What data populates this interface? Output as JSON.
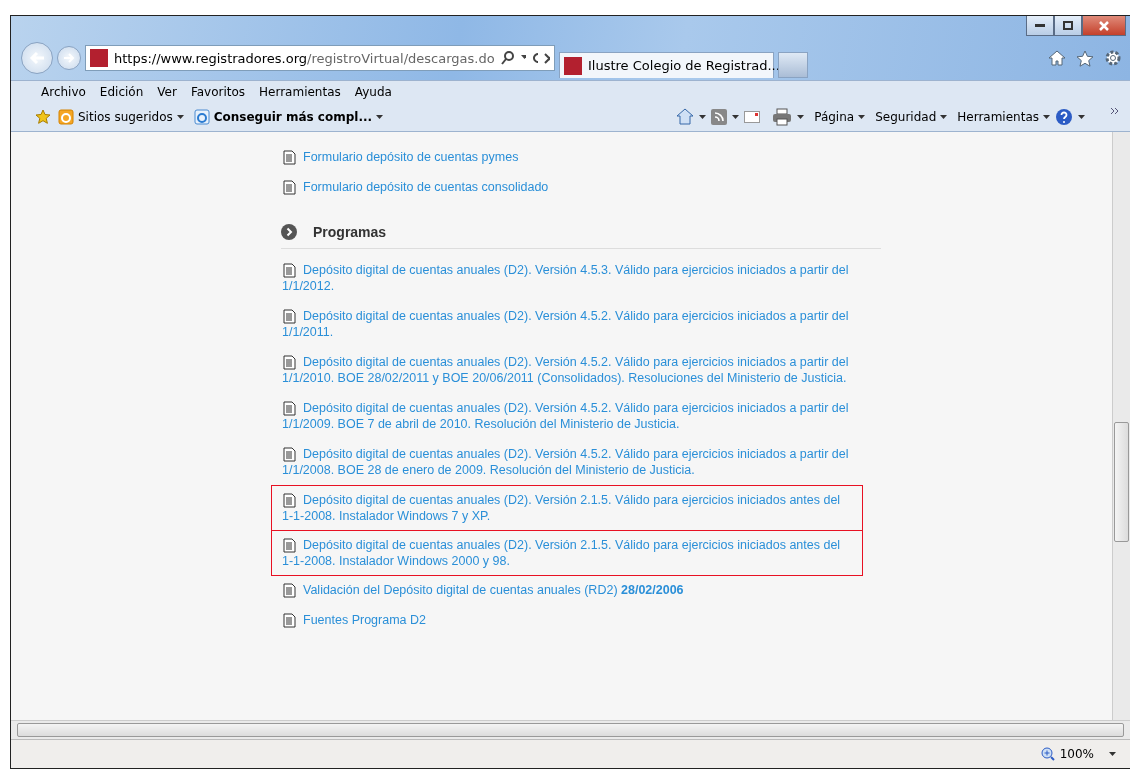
{
  "address_bar": {
    "host": "https://www.registradores.org",
    "path": "/registroVirtual/descargas.do"
  },
  "tab": {
    "title": "Ilustre Colegio de Registrad..."
  },
  "menu": [
    "Archivo",
    "Edición",
    "Ver",
    "Favoritos",
    "Herramientas",
    "Ayuda"
  ],
  "favorites_bar": [
    {
      "label": "Sitios sugeridos",
      "bold": false
    },
    {
      "label": "Conseguir más compl...",
      "bold": true
    }
  ],
  "command_bar": [
    "Página",
    "Seguridad",
    "Herramientas"
  ],
  "forms": [
    {
      "text": "Formulario depósito de cuentas pymes"
    },
    {
      "text": "Formulario depósito de cuentas consolidado"
    }
  ],
  "section": {
    "title": "Programas"
  },
  "programs": [
    {
      "text": "Depósito digital de cuentas anuales (D2). Versión 4.5.3. Válido para ejercicios iniciados a partir del 1/1/2012.",
      "highlighted": false
    },
    {
      "text": "Depósito digital de cuentas anuales (D2). Versión 4.5.2. Válido para ejercicios iniciados a partir del 1/1/2011.",
      "highlighted": false
    },
    {
      "text": "Depósito digital de cuentas anuales (D2). Versión 4.5.2. Válido para ejercicios iniciados a partir del 1/1/2010. BOE 28/02/2011 y BOE 20/06/2011 (Consolidados). Resoluciones del Ministerio de Justicia.",
      "highlighted": false
    },
    {
      "text": "Depósito digital de cuentas anuales (D2). Versión 4.5.2. Válido para ejercicios iniciados a partir del 1/1/2009. BOE 7 de abril de 2010. Resolución del Ministerio de Justicia.",
      "highlighted": false
    },
    {
      "text": "Depósito digital de cuentas anuales (D2). Versión 4.5.2. Válido para ejercicios iniciados a partir del 1/1/2008. BOE 28 de enero de 2009. Resolución del Ministerio de Justicia.",
      "highlighted": false
    },
    {
      "text": "Depósito digital de cuentas anuales (D2). Versión 2.1.5. Válido para ejercicios iniciados antes del 1-1-2008. Instalador Windows 7 y XP.",
      "highlighted": true
    },
    {
      "text": "Depósito digital de cuentas anuales (D2). Versión 2.1.5. Válido para ejercicios iniciados antes del 1-1-2008. Instalador Windows 2000 y 98.",
      "highlighted": true
    },
    {
      "text": "Validación del Depósito digital de cuentas anuales (RD2) **28/02/2006**",
      "highlighted": false
    },
    {
      "text": "Fuentes Programa D2",
      "highlighted": false
    }
  ],
  "status_bar": {
    "zoom": "100%"
  }
}
